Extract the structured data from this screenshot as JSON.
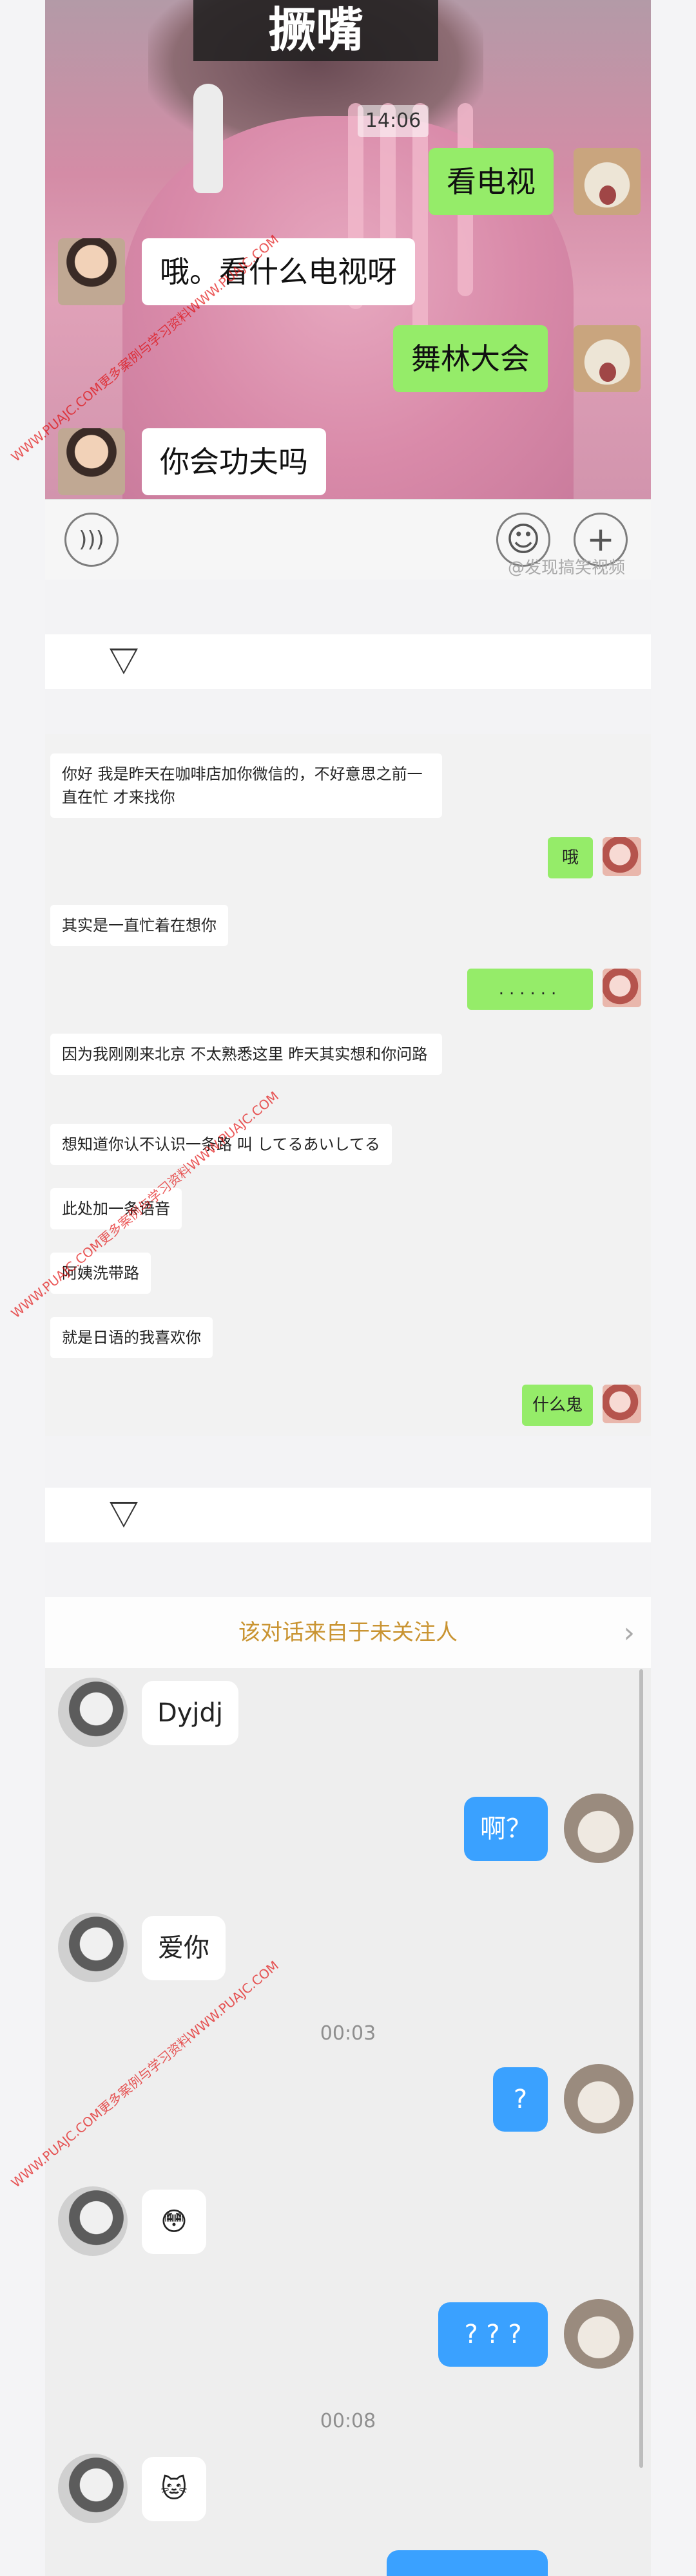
{
  "panel1": {
    "sticker_caption": "撅嘴",
    "time": "14:06",
    "messages": [
      {
        "side": "right",
        "text": "看电视"
      },
      {
        "side": "left",
        "text": "哦。看什么电视呀"
      },
      {
        "side": "right",
        "text": "舞林大会"
      },
      {
        "side": "left",
        "text": "你会功夫吗"
      }
    ],
    "weibo_watermark": "@发现搞笑视频",
    "voice_icon": "voice-icon",
    "emoji_icon": "emoji-icon",
    "plus_icon": "plus-icon"
  },
  "panel2": {
    "messages": [
      {
        "side": "left",
        "text": "你好 我是昨天在咖啡店加你微信的，不好意思之前一直在忙 才来找你"
      },
      {
        "side": "right",
        "text": "哦"
      },
      {
        "side": "left",
        "text": "其实是一直忙着在想你"
      },
      {
        "side": "right",
        "text": "......"
      },
      {
        "side": "left",
        "text": "因为我刚刚来北京 不太熟悉这里 昨天其实想和你问路"
      },
      {
        "side": "left",
        "text": "想知道你认不认识一条路 叫 してるあいしてる"
      },
      {
        "side": "left",
        "text": "此处加一条语音"
      },
      {
        "side": "left",
        "text": "阿姨洗带路"
      },
      {
        "side": "left",
        "text": "就是日语的我喜欢你"
      },
      {
        "side": "right",
        "text": "什么鬼"
      }
    ]
  },
  "panel3": {
    "notice": "该对话来自于未关注人",
    "notice_chevron": "›",
    "messages": [
      {
        "side": "left",
        "text": "Dyjdj"
      },
      {
        "side": "right",
        "text": "啊？"
      },
      {
        "side": "left",
        "text": "爱你"
      },
      {
        "side": "right",
        "text": "?"
      },
      {
        "side": "left",
        "text": "😳"
      },
      {
        "side": "right",
        "text": "? ? ?"
      },
      {
        "side": "left",
        "text": "🐱"
      }
    ],
    "timestamps": [
      "00:03",
      "00:08"
    ]
  },
  "divider_icon": "down-triangle-icon",
  "watermark": "WWW.PUAJC.COM更多案例与学习资料WWW.PUAJC.COM"
}
